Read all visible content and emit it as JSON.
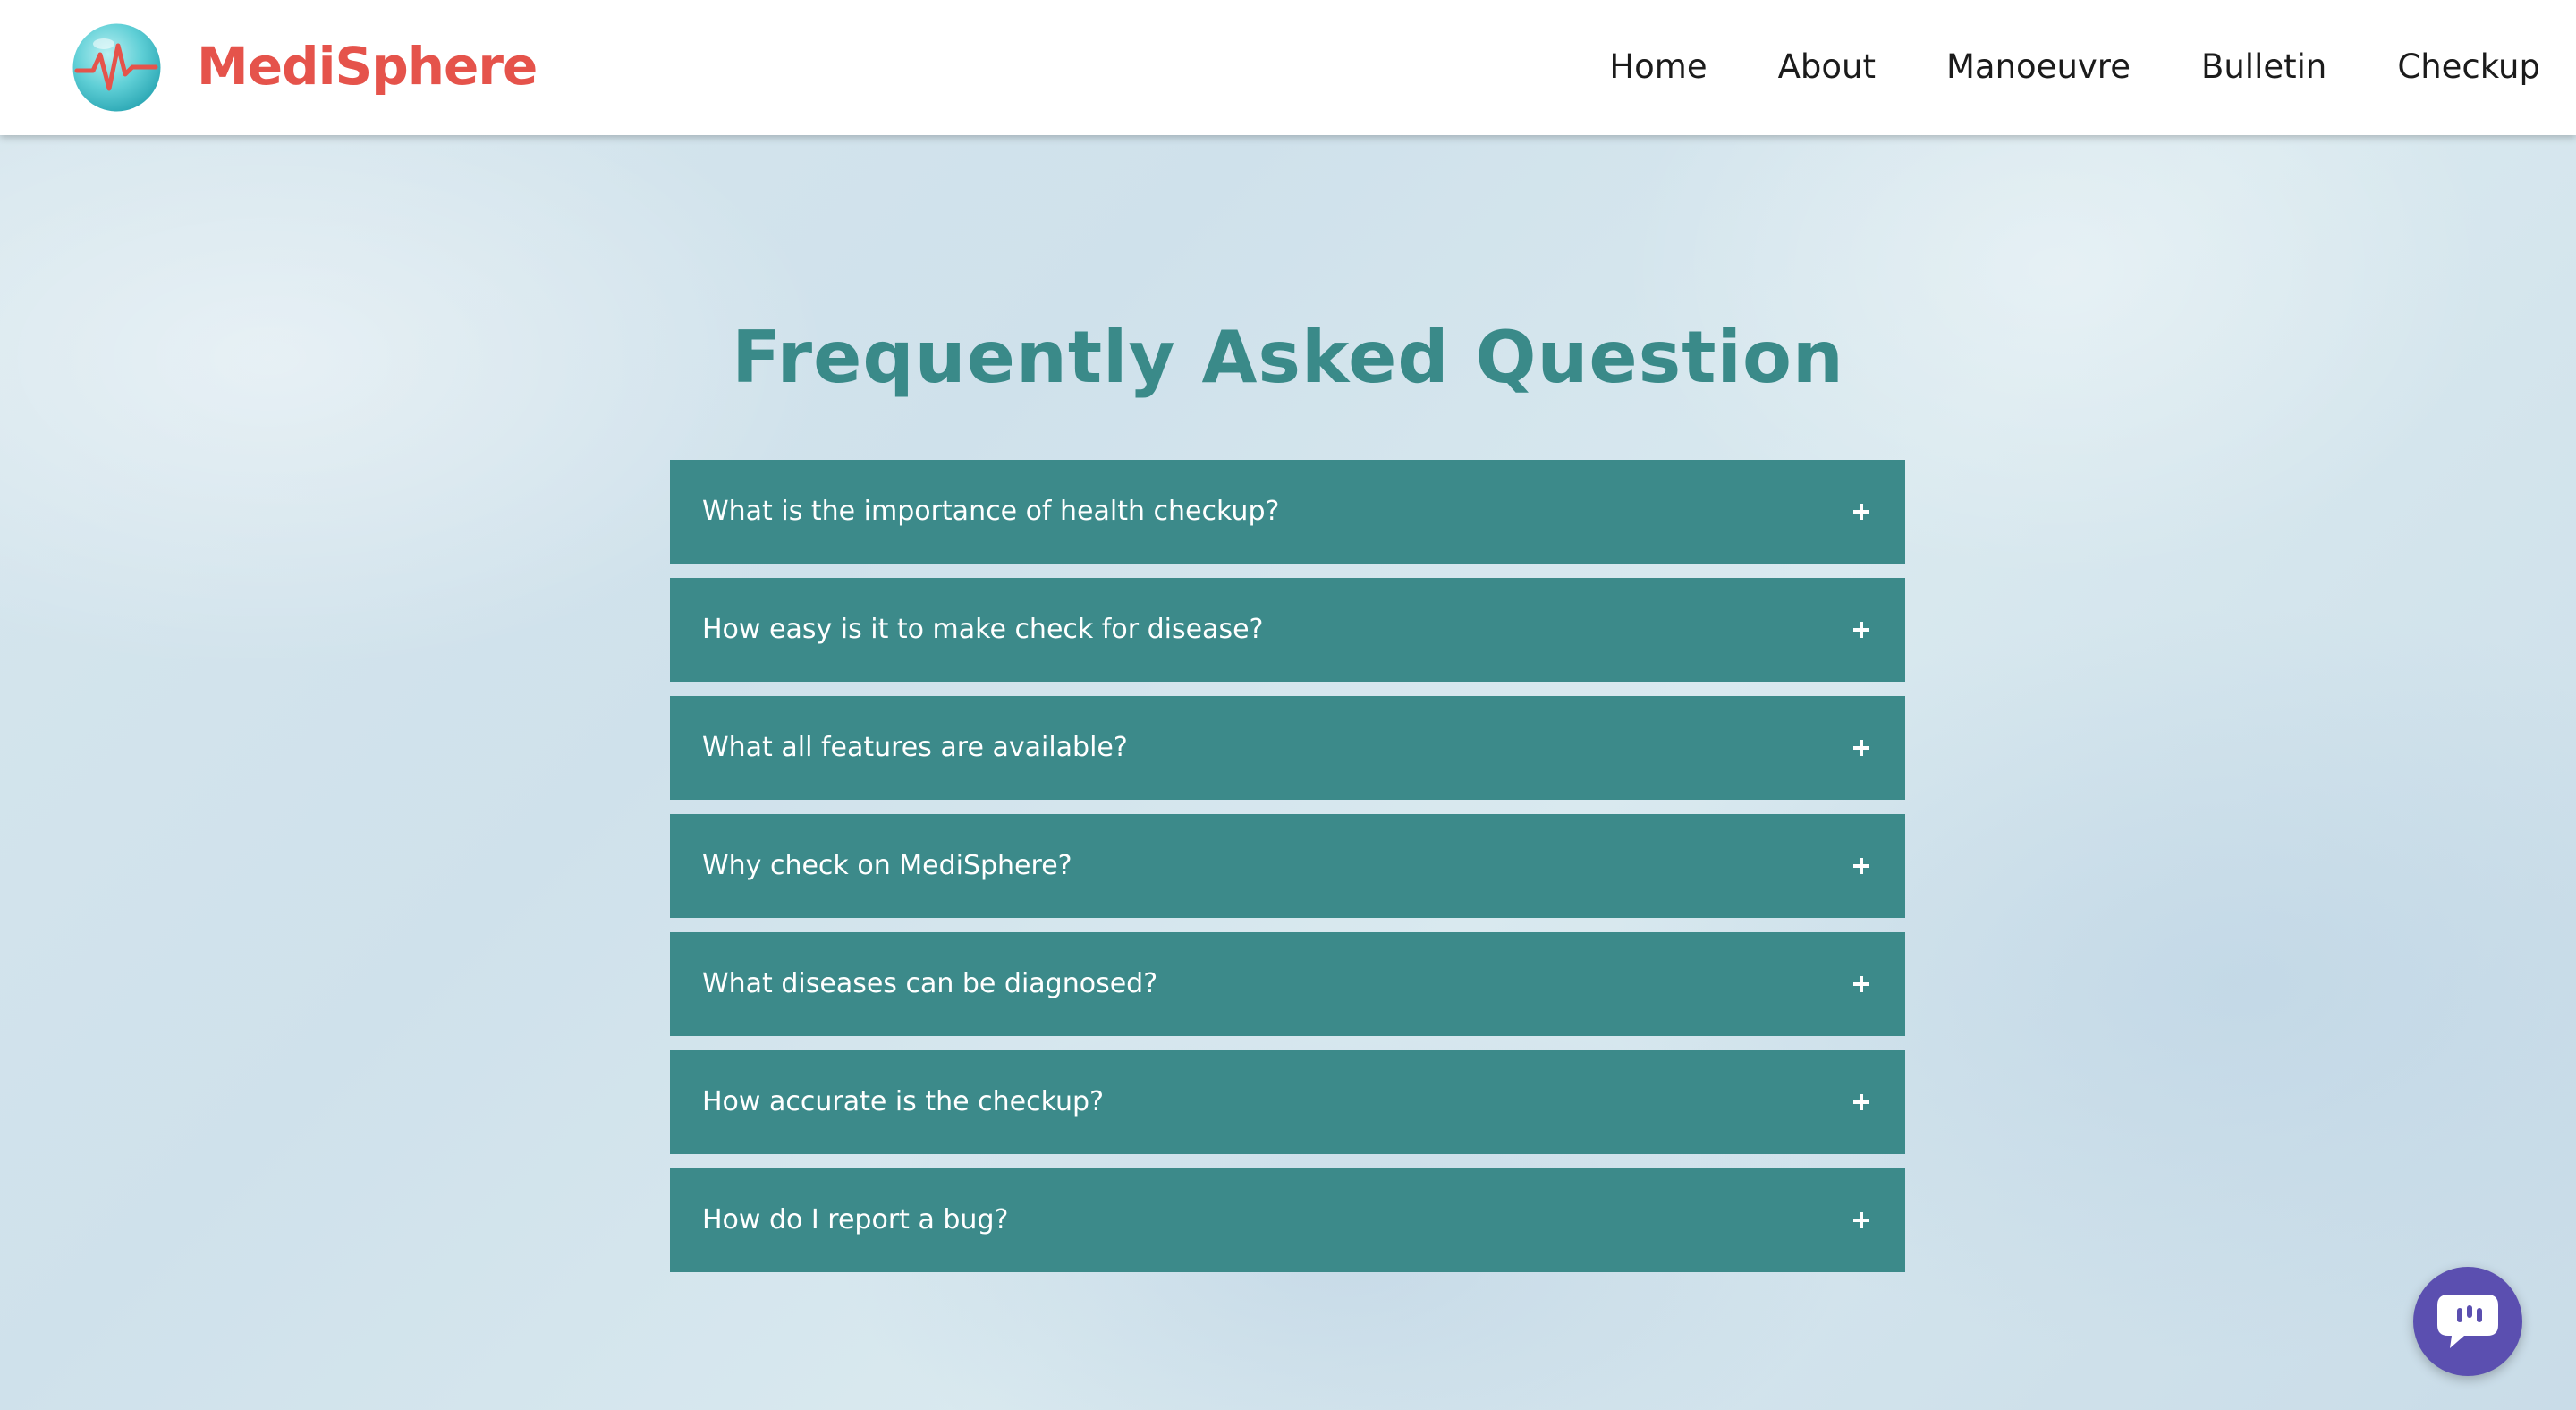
{
  "brand": {
    "name": "MediSphere",
    "logo_icon": "heartbeat-globe-icon",
    "name_color": "#e5534b"
  },
  "nav": {
    "items": [
      {
        "label": "Home"
      },
      {
        "label": "About"
      },
      {
        "label": "Manoeuvre"
      },
      {
        "label": "Bulletin"
      },
      {
        "label": "Checkup"
      }
    ]
  },
  "faq": {
    "title": "Frequently Asked Question",
    "title_color": "#3a8a89",
    "item_color": "#3c8a8a",
    "toggle_icon": "plus-icon",
    "items": [
      {
        "question": "What is the importance of health checkup?"
      },
      {
        "question": "How easy is it to make check for disease?"
      },
      {
        "question": "What all features are available?"
      },
      {
        "question": "Why check on MediSphere?"
      },
      {
        "question": "What diseases can be diagnosed?"
      },
      {
        "question": "How accurate is the checkup?"
      },
      {
        "question": "How do I report a bug?"
      }
    ]
  },
  "chat_widget": {
    "icon": "chat-bubble-icon",
    "color": "#5b4fb0"
  }
}
